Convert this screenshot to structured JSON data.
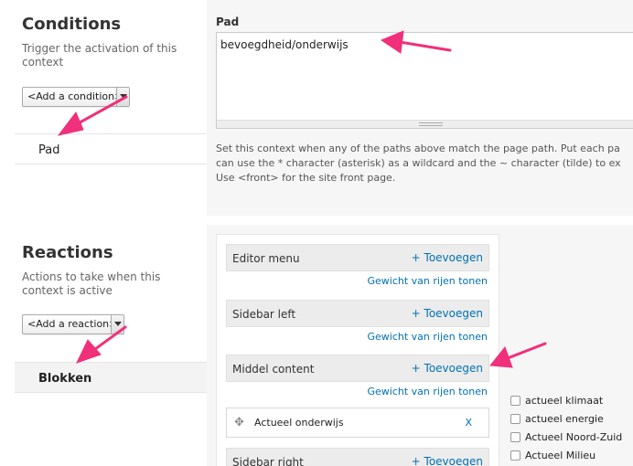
{
  "conditions": {
    "title": "Conditions",
    "description": "Trigger the activation of this context",
    "select_value": "<Add a condition>",
    "items": [
      "Pad"
    ]
  },
  "reactions": {
    "title": "Reactions",
    "description": "Actions to take when this context is active",
    "select_value": "<Add a reaction>",
    "items": [
      "Blokken"
    ]
  },
  "path_field": {
    "label": "Pad",
    "value": "bevoegdheid/onderwijs",
    "help_line1": "Set this context when any of the paths above match the page path. Put each pa",
    "help_line2": "can use the * character (asterisk) as a wildcard and the ~ character (tilde) to ex",
    "help_line3": "Use <front> for the site front page."
  },
  "blocks": {
    "add_label": "+ Toevoegen",
    "weights_label": "Gewicht van rijen tonen",
    "regions": [
      "Editor menu",
      "Sidebar left",
      "Middel content",
      "Sidebar right"
    ],
    "block_name": "Actueel onderwijs",
    "remove_label": "X",
    "checkboxes": [
      "actueel klimaat",
      "actueel energie",
      "Actueel Noord-Zuid",
      "Actueel Milieu"
    ]
  },
  "colors": {
    "link": "#0071b3",
    "annotation_arrow": "#f0307a",
    "panel_bg": "#f6f6f6"
  },
  "icons": {
    "drag_handle": "move-icon",
    "dropdown": "chevron-down-icon"
  }
}
